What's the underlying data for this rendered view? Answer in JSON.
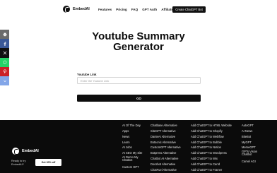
{
  "nav": {
    "brand": "EmbedAI",
    "links": [
      "Features",
      "Pricing",
      "FAQ",
      "GPT Auth",
      "Affiliate"
    ],
    "cta": "Create ChatGPT Bot"
  },
  "share": {
    "buttons": [
      {
        "name": "print-icon",
        "color": "#6b6b6b"
      },
      {
        "name": "facebook-icon",
        "color": "#3b5998"
      },
      {
        "name": "x-twitter-icon",
        "color": "#111111"
      },
      {
        "name": "whatsapp-icon",
        "color": "#25d366"
      },
      {
        "name": "pinterest-icon",
        "color": "#cb2027"
      },
      {
        "name": "more-icon",
        "color": "#83a6e8"
      }
    ]
  },
  "hero": {
    "title_line1": "Youtube Summary",
    "title_line2": "Generator"
  },
  "form": {
    "label": "Youtube Link",
    "placeholder": "Enter the Youtube Link",
    "submit": "GO"
  },
  "footer": {
    "brand": "EmbedAI",
    "tagline_line1": "Ready to try",
    "tagline_line2": "EmbedAI?",
    "cta": "Get 30% off",
    "col1": [
      "AI Of The Day",
      "Apps",
      "News",
      "Learn",
      "AI Jobs",
      "AI SEO My Site",
      "AI Demo My Chatbot",
      "Custom GPT"
    ],
    "col2": [
      "Chatbase Alternative",
      "SiteGPT Alternative",
      "DanteAI Alternative",
      "Botsonic Alternative",
      "CustomGPT Alternative",
      "Botpress Alternative",
      "Chatbot AI Alternative",
      "Docsbot Alternative",
      "ChatFuel Alternative"
    ],
    "col3": [
      "Add ChatGPT to HTML Website",
      "Add ChatGPT to Shopify",
      "Add ChatGPT to Webflow",
      "Add ChatGPT to Bubble",
      "Add ChatGPT to Notion",
      "Add ChatGPT to Wordpress",
      "Add ChatGPT to Wix",
      "Add ChatGPT to Carrd",
      "Add ChatGPT to Framer"
    ],
    "col4": [
      "AutoGPT",
      "AI News",
      "BiteBot",
      "MyGPT",
      "MemeGPT",
      "GPTs Vision Chatbot",
      "Camel AGI"
    ]
  }
}
